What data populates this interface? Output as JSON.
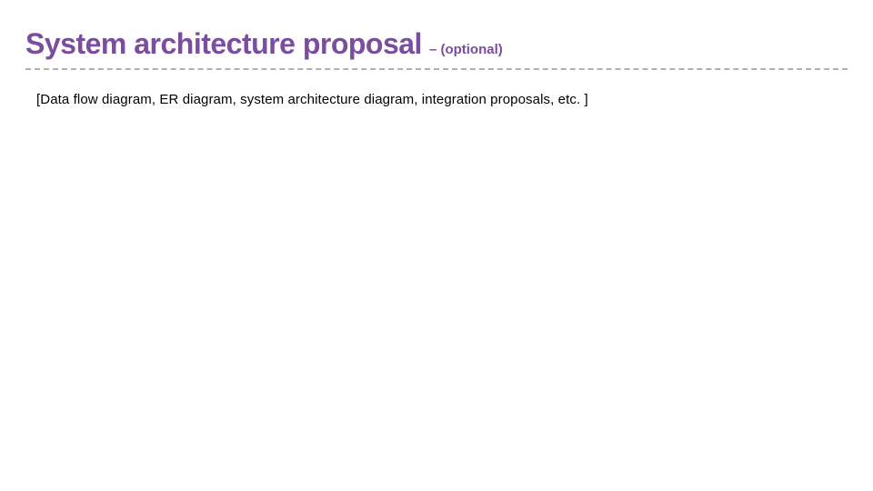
{
  "heading": {
    "title": "System architecture proposal",
    "subtitle": "– (optional)"
  },
  "body": {
    "placeholder": "[Data flow diagram, ER diagram, system architecture diagram, integration proposals, etc. ]"
  }
}
